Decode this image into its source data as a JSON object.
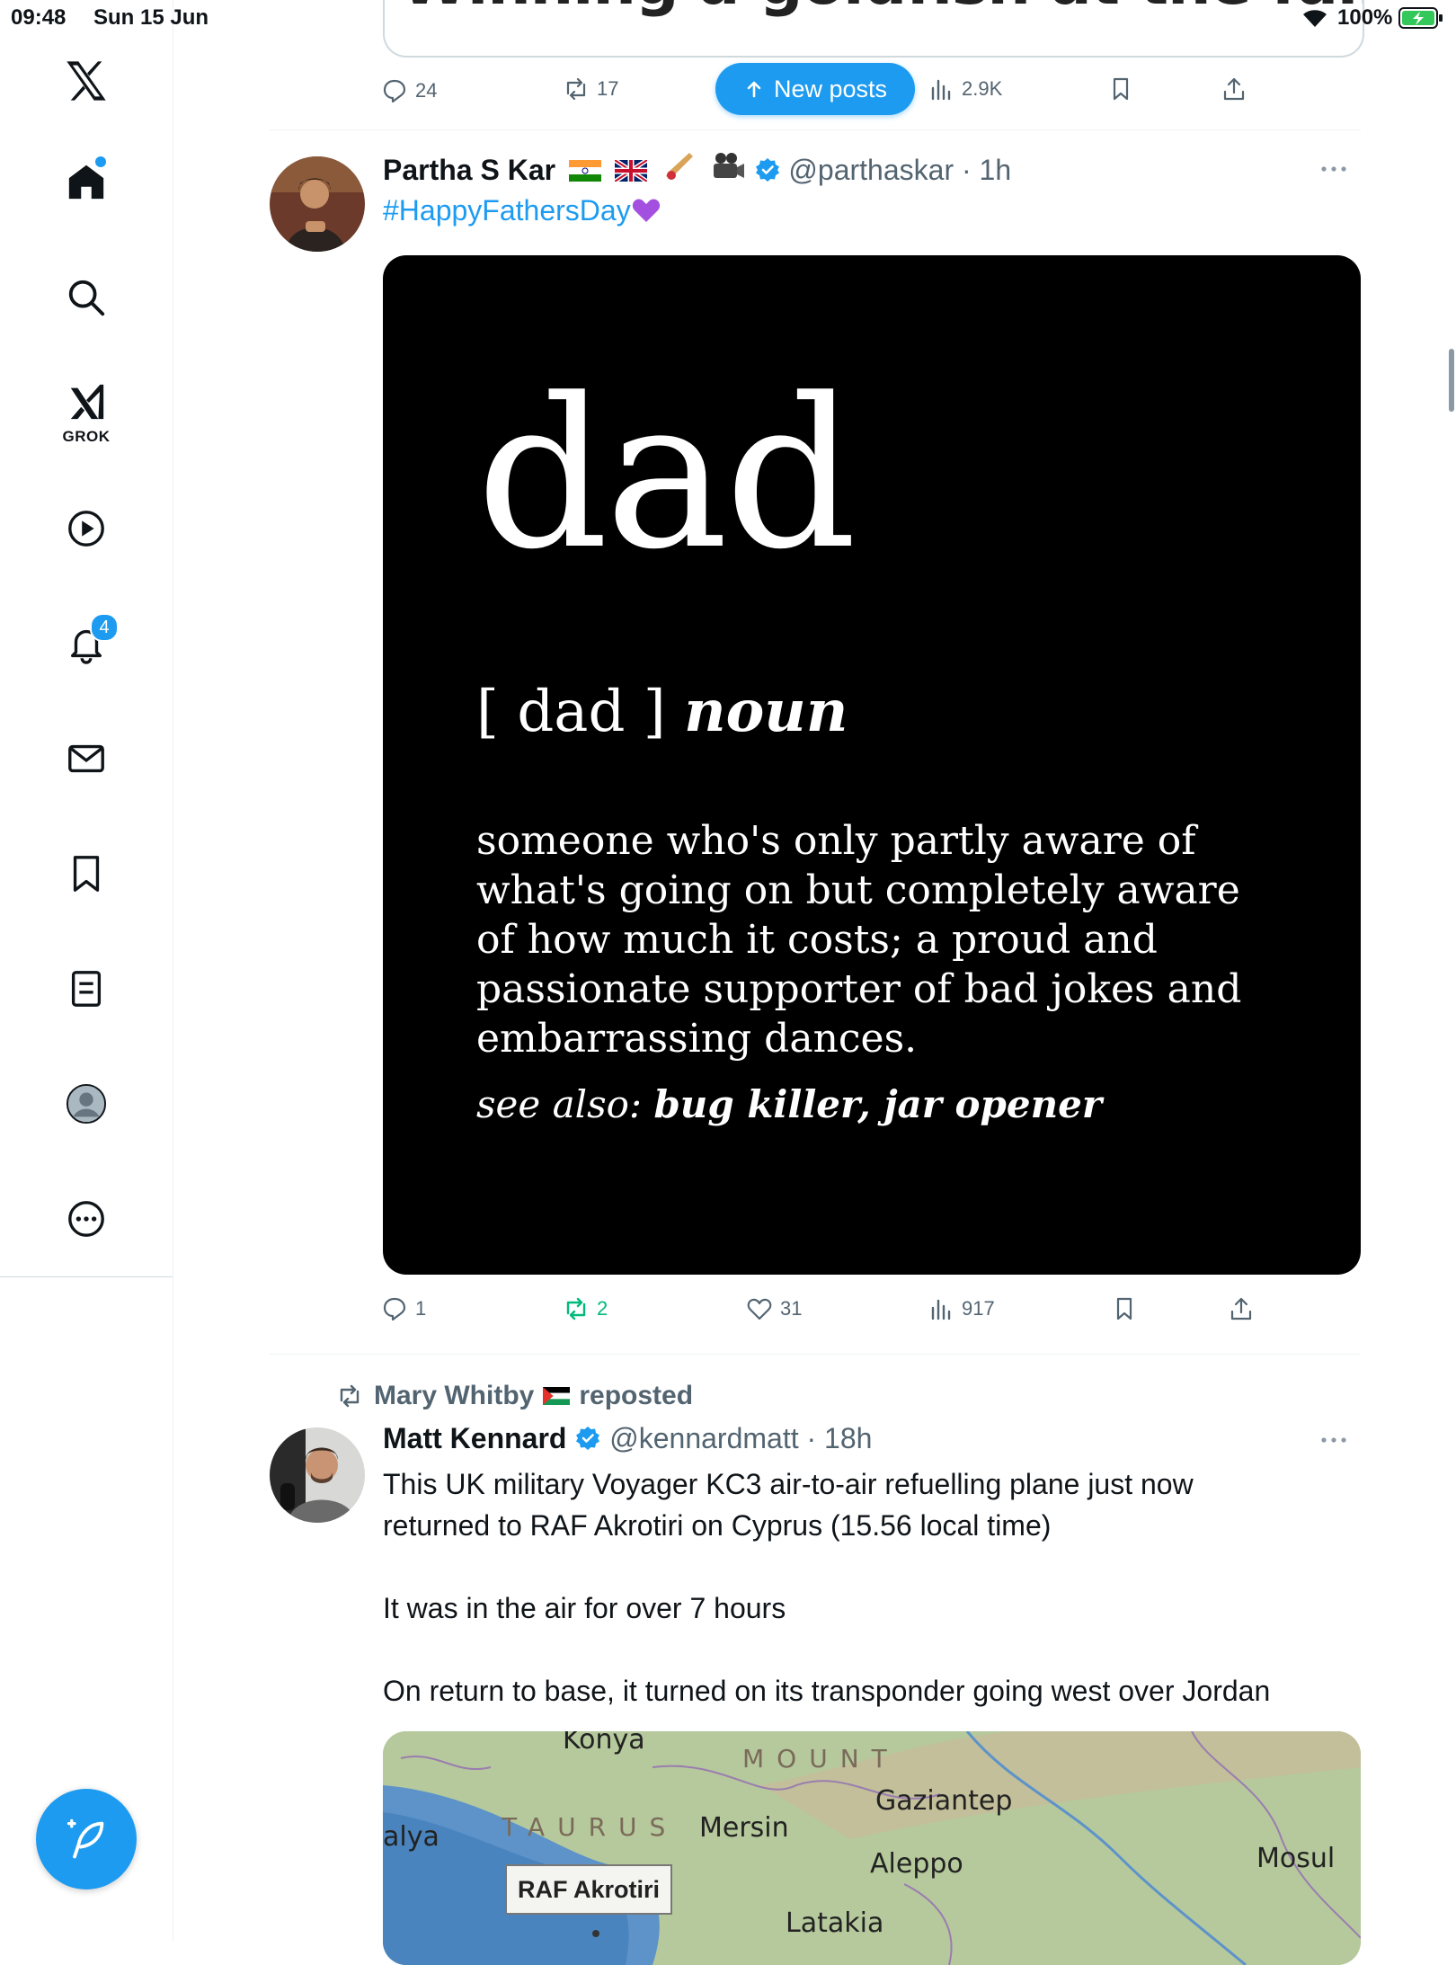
{
  "status_bar": {
    "time": "09:48",
    "date": "Sun 15 Jun",
    "battery": "100%"
  },
  "sidebar": {
    "grok_label": "GROK",
    "notification_count": "4"
  },
  "new_posts_label": "New posts",
  "previous_post": {
    "image_text": "Winning a goldfish at the fair!",
    "replies": "24",
    "reposts": "17",
    "views": "2.9K"
  },
  "post1": {
    "name": "Partha S Kar",
    "handle": "@parthaskar",
    "time": "1h",
    "text": "#HappyFathersDay",
    "image": {
      "word": "dad",
      "pronunciation": "[ dad ]",
      "part_of_speech": "noun",
      "definition": "someone who's only partly aware of what's going on but completely aware of how much it costs; a proud and passionate supporter of bad jokes and embarrassing dances.",
      "see_also_label": "see also:",
      "see_also": "bug killer, jar opener"
    },
    "replies": "1",
    "reposts": "2",
    "likes": "31",
    "views": "917"
  },
  "post2": {
    "reposted_by": "Mary Whitby",
    "reposted_suffix": "reposted",
    "name": "Matt Kennard",
    "handle": "@kennardmatt",
    "time": "18h",
    "text_line1": "This UK military Voyager KC3 air-to-air refuelling plane just now",
    "text_line2": "returned to RAF Akrotiri on Cyprus (15.56 local time)",
    "text_para2": "It was in the air for over 7 hours",
    "text_para3": "On return to base, it turned on its transponder going west over Jordan",
    "map": {
      "labels": [
        "Konya",
        "Gaziantep",
        "Mersin",
        "Aleppo",
        "Mosul",
        "alya",
        "Latakia"
      ],
      "mountains_1": "TAURUS",
      "mountains_2": "MOUNT",
      "base_label": "RAF Akrotiri"
    }
  },
  "colors": {
    "accent": "#1d9bf0",
    "repost_green": "#00ba7c",
    "secondary_text": "#536471"
  }
}
